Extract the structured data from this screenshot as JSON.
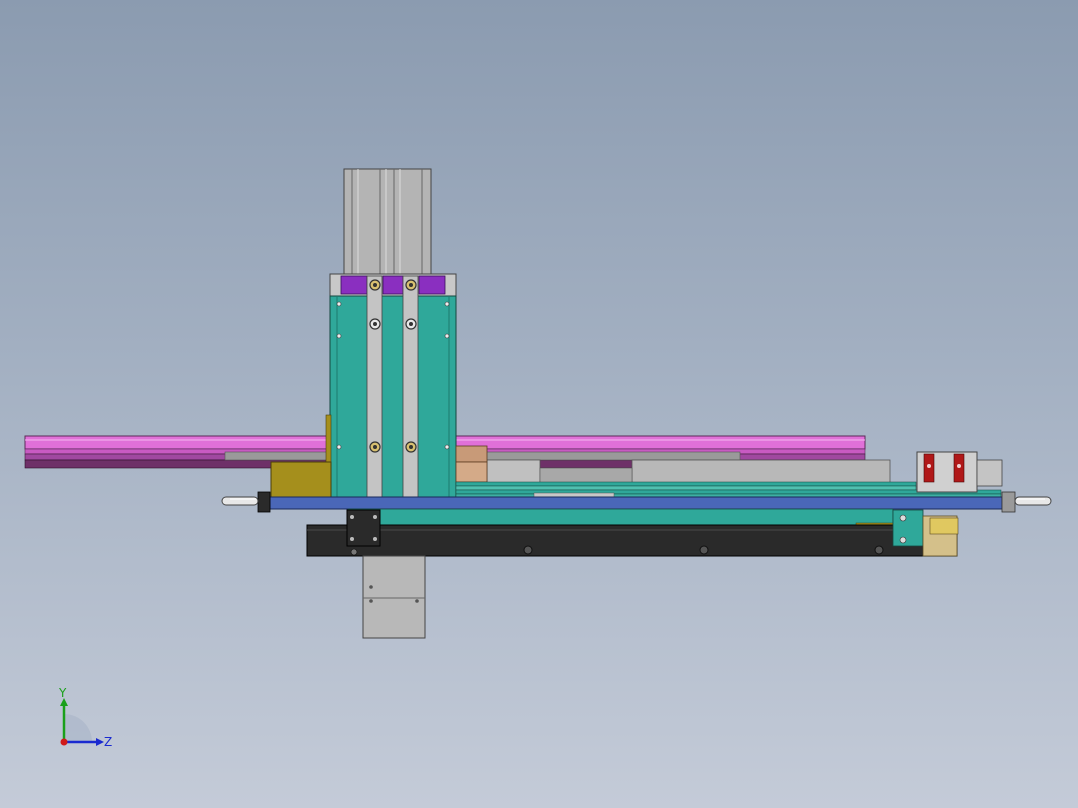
{
  "axes": {
    "y_label": "Y",
    "z_label": "Z"
  },
  "colors": {
    "background_top": "#8b9bb0",
    "background_bottom": "#c4cbd8",
    "teal": "#2fa89a",
    "purple": "#8a2fc0",
    "magenta_rail": "#e070d8",
    "olive": "#a58f1c",
    "blue_plate": "#4a67b8",
    "black_base": "#2a2a2a",
    "gray": "#b0b0b0",
    "red_connector": "#b01818",
    "axis_y": "#1aa01a",
    "axis_z": "#1a2ad0",
    "axis_x": "#d01a1a"
  }
}
